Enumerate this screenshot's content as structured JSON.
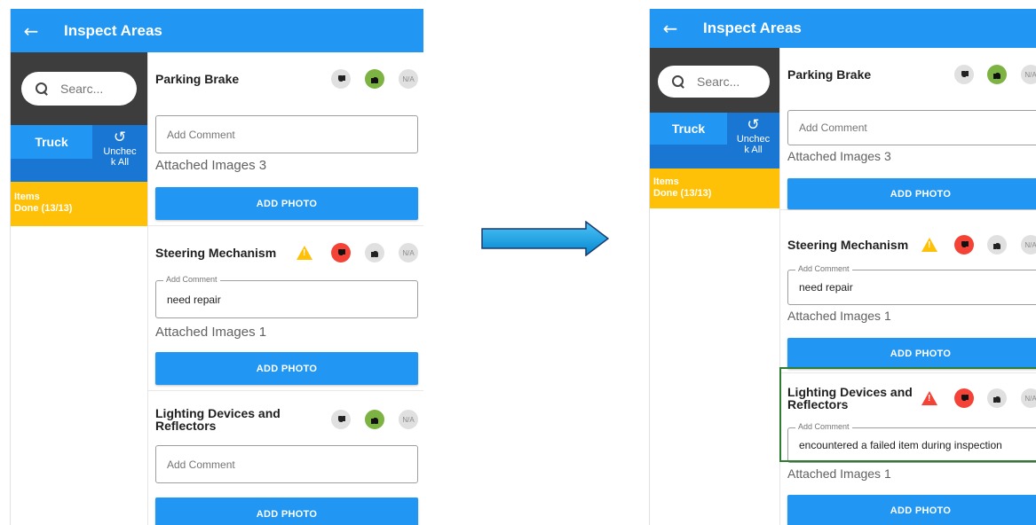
{
  "left_screen": {
    "title": "Inspect Areas",
    "search_placeholder": "Searc...",
    "tab_truck": "Truck",
    "uncheck_line1": "Unchec",
    "uncheck_line2": "k All",
    "items_done_line1": "Items",
    "items_done_line2": "Done (13/13)",
    "cards": [
      {
        "title": "Parking Brake",
        "comment": "Add Comment",
        "attached": "Attached Images 3",
        "button": "ADD PHOTO",
        "selected": "up"
      },
      {
        "title": "Steering Mechanism",
        "comment_label": "Add Comment",
        "comment": "need repair",
        "attached": "Attached Images 1",
        "button": "ADD PHOTO",
        "selected": "down",
        "warning": "yellow"
      },
      {
        "title_line1": "Lighting Devices and",
        "title_line2": "Reflectors",
        "comment": "Add Comment",
        "button": "ADD PHOTO",
        "selected": "up"
      }
    ]
  },
  "right_screen": {
    "title": "Inspect Areas",
    "search_placeholder": "Searc...",
    "tab_truck": "Truck",
    "uncheck_line1": "Unchec",
    "uncheck_line2": "k All",
    "items_done_line1": "Items",
    "items_done_line2": "Done (13/13)",
    "cards": [
      {
        "title": "Parking Brake",
        "comment": "Add Comment",
        "attached": "Attached Images 3",
        "button": "ADD PHOTO",
        "selected": "up"
      },
      {
        "title": "Steering Mechanism",
        "comment_label": "Add Comment",
        "comment": "need repair",
        "attached": "Attached Images 1",
        "button": "ADD PHOTO",
        "selected": "down",
        "warning": "yellow"
      },
      {
        "title_line1": "Lighting Devices and",
        "title_line2": "Reflectors",
        "comment_label": "Add Comment",
        "comment": "encountered a failed item during inspection",
        "attached": "Attached Images 1",
        "button": "ADD PHOTO",
        "selected": "down",
        "warning": "red"
      }
    ]
  },
  "na_label": "N/A",
  "icons": {
    "back": "arrow-left-icon",
    "search": "search-icon",
    "uncheck": "undo-icon",
    "up": "thumb-up-icon",
    "down": "thumb-down-icon",
    "warning": "warning-icon"
  },
  "colors": {
    "primary": "#2196f3",
    "dark_blue": "#1976d2",
    "amber": "#ffc107",
    "green": "#7cb342",
    "red": "#f44336",
    "highlight": "#2e7d32"
  }
}
